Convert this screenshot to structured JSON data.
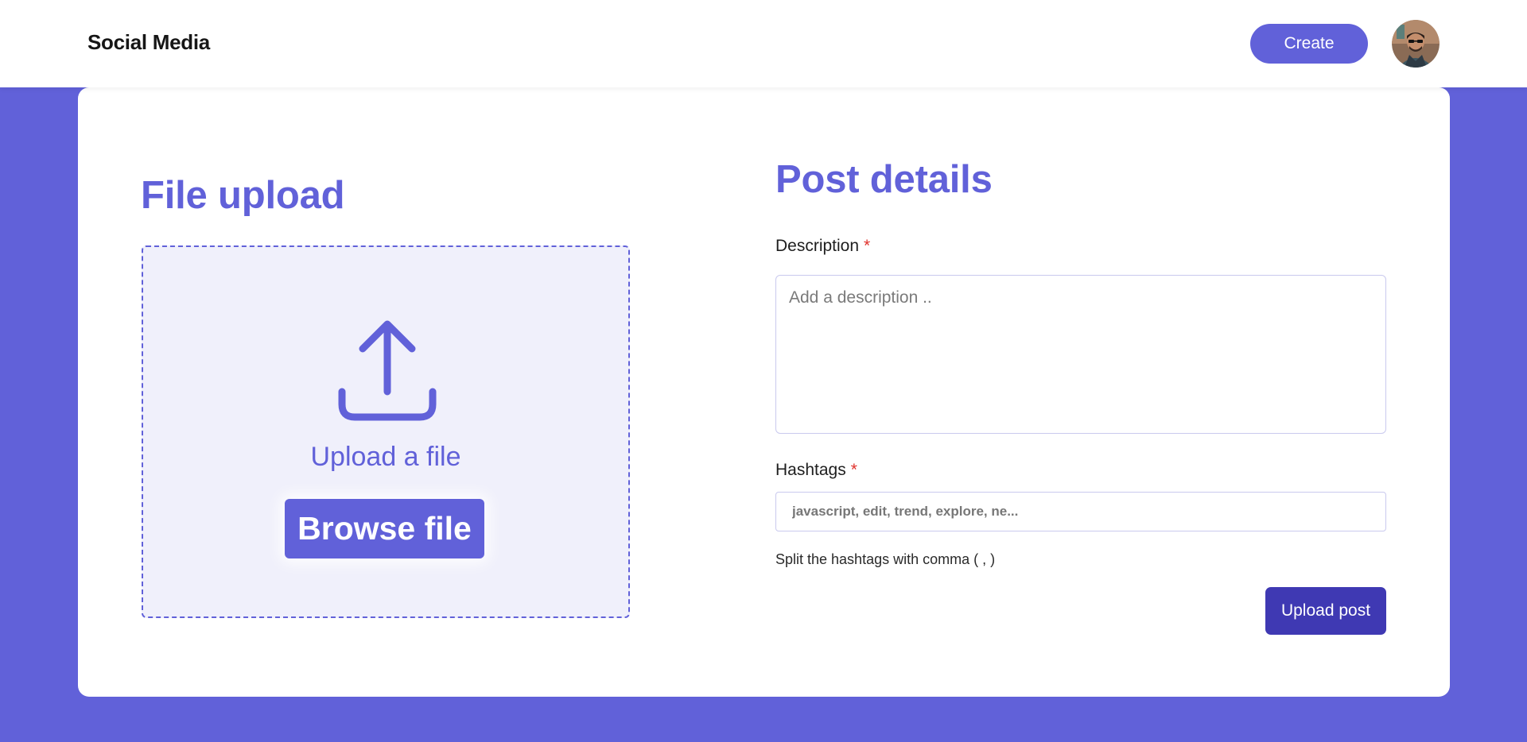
{
  "header": {
    "brand": "Social Media",
    "create_label": "Create",
    "avatar_icon": "user-avatar"
  },
  "upload": {
    "title": "File upload",
    "icon": "upload-icon",
    "label": "Upload a file",
    "browse_label": "Browse file"
  },
  "post": {
    "title": "Post details",
    "description_label": "Description",
    "description_placeholder": "Add a description ..",
    "description_value": "",
    "hashtags_label": "Hashtags",
    "hashtags_placeholder": "javascript, edit, trend, explore, ne...",
    "hashtags_value": "",
    "required_mark": "*",
    "hint": "Split the hashtags with comma ( , )",
    "submit_label": "Upload post"
  },
  "colors": {
    "accent": "#6161d9",
    "accent_dark": "#3f39b3",
    "required": "#e0322c",
    "dropzone_bg": "#f0f0fb"
  }
}
